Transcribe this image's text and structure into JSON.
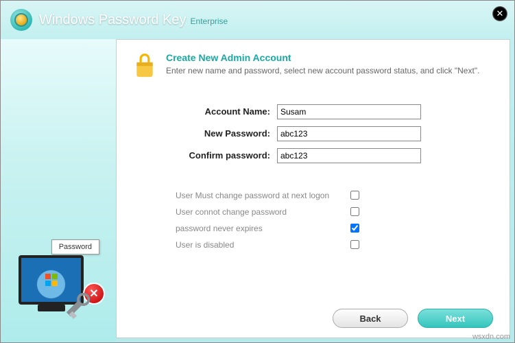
{
  "header": {
    "title": "Windows Password Key",
    "edition": "Enterprise"
  },
  "sidebar": {
    "badge": "Password"
  },
  "intro": {
    "heading": "Create New Admin Account",
    "description": "Enter new name and password, select new account password status, and click \"Next\"."
  },
  "form": {
    "account_name": {
      "label": "Account Name:",
      "value": "Susam"
    },
    "new_password": {
      "label": "New Password:",
      "value": "abc123"
    },
    "confirm_password": {
      "label": "Confirm password:",
      "value": "abc123"
    }
  },
  "options": [
    {
      "label": "User Must change password at next logon",
      "checked": false
    },
    {
      "label": "User connot change password",
      "checked": false
    },
    {
      "label": "password never expires",
      "checked": true
    },
    {
      "label": "User is disabled",
      "checked": false
    }
  ],
  "footer": {
    "back": "Back",
    "next": "Next"
  },
  "watermark": "wsxdn.com"
}
